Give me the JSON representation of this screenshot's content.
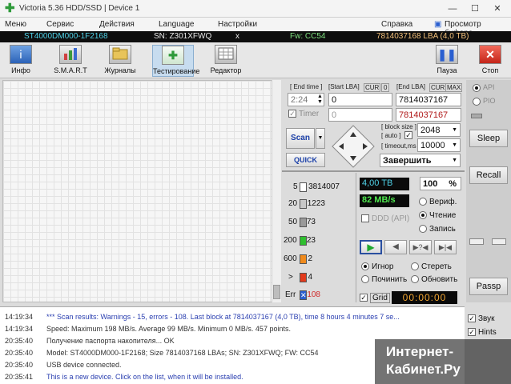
{
  "window": {
    "title": "Victoria 5.36 HDD/SSD | Device 1",
    "controls": [
      "—",
      "☐",
      "✕"
    ]
  },
  "menu": [
    "Меню",
    "Сервис",
    "Действия",
    "Language",
    "Настройки",
    "Справка",
    "Просмотр буфера"
  ],
  "drive": {
    "model": "ST4000DM000-1F2168",
    "serial": "SN: Z301XFWQ",
    "x": "x",
    "firmware": "Fw: CC54",
    "capacity": "7814037168 LBA (4,0 TB)"
  },
  "toolbar": {
    "info": "Инфо",
    "smart": "S.M.A.R.T",
    "logs": "Журналы",
    "testing": "Тестирование",
    "editor": "Редактор",
    "pause": "Пауза",
    "stop": "Стоп"
  },
  "test": {
    "end_time_label": "[ End time ]",
    "end_time": "2:24",
    "start_lba_label": "[Start LBA]",
    "cur_label": "CUR",
    "zero": "0",
    "start_lba": "0",
    "end_lba_label": "[End LBA]",
    "max_label": "MAX",
    "end_lba": "7814037167",
    "end_lba_current": "7814037167",
    "timer_label": "Timer",
    "timer_value": "0",
    "scan": "Scan",
    "quick": "QUICK",
    "block_size_label": "[ block size ]",
    "auto_label": "[ auto ]",
    "timeout_label": "[ timeout,ms ]",
    "block_size": "2048",
    "timeout": "10000",
    "finish_action": "Завершить"
  },
  "api": {
    "api": "API",
    "pio": "PIO"
  },
  "side_buttons": {
    "sleep": "Sleep",
    "recall": "Recall",
    "passp": "Passp"
  },
  "legend": [
    {
      "label": "5",
      "count": "3814007",
      "color": "#ffffff"
    },
    {
      "label": "20",
      "count": "1223",
      "color": "#c8c8c8"
    },
    {
      "label": "50",
      "count": "73",
      "color": "#9a9a9a"
    },
    {
      "label": "200",
      "count": "23",
      "color": "#2fbf2f"
    },
    {
      "label": "600",
      "count": "2",
      "color": "#f08a1c"
    },
    {
      "label": ">",
      "count": "4",
      "color": "#e23a1c"
    },
    {
      "label": "Err",
      "count": "108",
      "color": "#2a5fd0"
    }
  ],
  "status": {
    "tb": "4,00 TB",
    "percent": "100",
    "percent_unit": "%",
    "speed": "82 MB/s",
    "ddd": "DDD (API)",
    "verify": "Вериф.",
    "read": "Чтение",
    "write": "Запись"
  },
  "actions": {
    "ignore": "Игнор",
    "erase": "Стереть",
    "repair": "Починить",
    "refresh": "Обновить",
    "grid": "Grid",
    "clock": "00:00:00"
  },
  "log": [
    {
      "time": "14:19:34",
      "msg": "*** Scan results: Warnings - 15, errors - 108. Last block at 7814037167 (4,0 TB), time 8 hours 4 minutes 7 se...",
      "color": "#2a3fb0"
    },
    {
      "time": "14:19:34",
      "msg": "Speed: Maximum 198 MB/s. Average 99 MB/s. Minimum 0 MB/s. 457 points.",
      "color": "#333333"
    },
    {
      "time": "20:35:40",
      "msg": "Получение паспорта накопителя... OK",
      "color": "#333333"
    },
    {
      "time": "20:35:40",
      "msg": "Model: ST4000DM000-1F2168; Size 7814037168 LBAs; SN: Z301XFWQ; FW: CC54",
      "color": "#333333"
    },
    {
      "time": "20:35:40",
      "msg": "USB device connected.",
      "color": "#333333"
    },
    {
      "time": "20:35:41",
      "msg": "This is a new device. Click on the list, when it will be installed.",
      "color": "#2a3fb0"
    }
  ],
  "log_options": {
    "sound": "Звук",
    "hints": "Hints"
  },
  "watermark": {
    "line1": "Интернет-",
    "line2": "Кабинет.Ру"
  }
}
